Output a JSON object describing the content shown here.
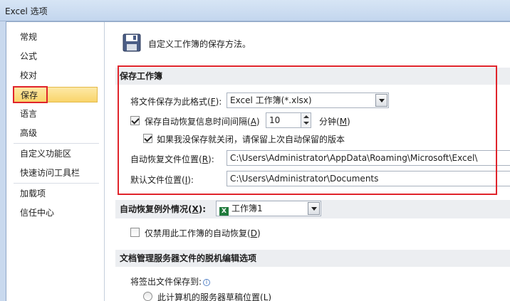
{
  "window": {
    "title": "Excel 选项"
  },
  "sidebar": {
    "items": [
      {
        "label": "常规"
      },
      {
        "label": "公式"
      },
      {
        "label": "校对"
      },
      {
        "label": "保存",
        "selected": true
      },
      {
        "label": "语言"
      },
      {
        "label": "高级"
      },
      {
        "label": "自定义功能区"
      },
      {
        "label": "快速访问工具栏"
      },
      {
        "label": "加载项"
      },
      {
        "label": "信任中心"
      }
    ]
  },
  "header": {
    "text": "自定义工作簿的保存方法。",
    "icon": "floppy-disk-icon"
  },
  "save_workbook": {
    "title": "保存工作簿",
    "format_label": "将文件保存为此格式(",
    "format_key": "F",
    "format_label_end": "):",
    "format_value": "Excel 工作簿(*.xlsx)",
    "autorecover_label": "保存自动恢复信息时间间隔(",
    "autorecover_key": "A",
    "autorecover_label_end": ")",
    "autorecover_checked": true,
    "interval_value": "10",
    "minutes_label": "分钟(",
    "minutes_key": "M",
    "minutes_label_end": ")",
    "keep_last_label": "如果我没保存就关闭，请保留上次自动保留的版本",
    "keep_last_checked": true,
    "autorecover_location_label": "自动恢复文件位置(",
    "autorecover_location_key": "R",
    "autorecover_location_label_end": "):",
    "autorecover_location_value": "C:\\Users\\Administrator\\AppData\\Roaming\\Microsoft\\Excel\\",
    "default_location_label": "默认文件位置(",
    "default_location_key": "I",
    "default_location_label_end": "):",
    "default_location_value": "C:\\Users\\Administrator\\Documents"
  },
  "autorecover_exceptions": {
    "title": "自动恢复例外情况(",
    "title_key": "X",
    "title_end": "):",
    "workbook_value": "工作簿1",
    "disable_label": "仅禁用此工作簿的自动恢复(",
    "disable_key": "D",
    "disable_label_end": ")",
    "disable_checked": false
  },
  "offline_editing": {
    "title": "文档管理服务器文件的脱机编辑选项",
    "save_to_label": "将签出文件保存到:",
    "server_drafts_label": "此计算机的服务器草稿位置(",
    "server_drafts_key": "L",
    "server_drafts_label_end": ")"
  },
  "colors": {
    "highlight_border": "#e0242b",
    "selected_item_bg": "#f9d56a",
    "section_header_bg": "#eceef1"
  }
}
